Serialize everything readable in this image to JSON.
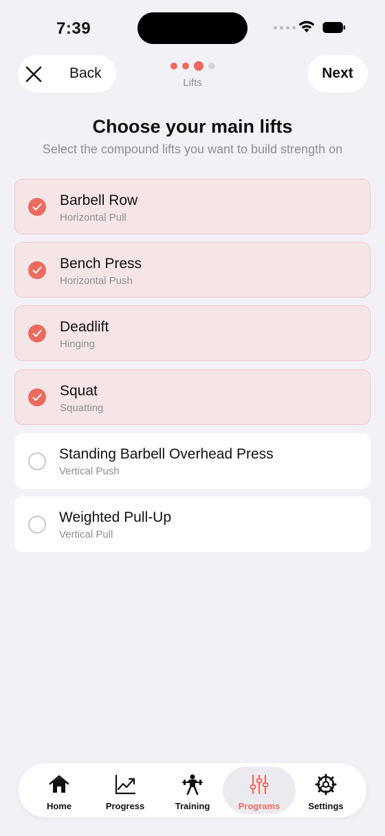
{
  "status_bar": {
    "time": "7:39"
  },
  "header": {
    "back_label": "Back",
    "next_label": "Next",
    "step_label": "Lifts",
    "steps": {
      "total": 4,
      "current": 3
    }
  },
  "title": "Choose your main lifts",
  "subtitle": "Select the compound lifts you want to build strength on",
  "lifts": [
    {
      "name": "Barbell Row",
      "category": "Horizontal Pull",
      "selected": true
    },
    {
      "name": "Bench Press",
      "category": "Horizontal Push",
      "selected": true
    },
    {
      "name": "Deadlift",
      "category": "Hinging",
      "selected": true
    },
    {
      "name": "Squat",
      "category": "Squatting",
      "selected": true
    },
    {
      "name": "Standing Barbell Overhead Press",
      "category": "Vertical Push",
      "selected": false
    },
    {
      "name": "Weighted Pull-Up",
      "category": "Vertical Pull",
      "selected": false
    }
  ],
  "tabs": [
    {
      "label": "Home",
      "icon": "house-icon",
      "active": false
    },
    {
      "label": "Progress",
      "icon": "chart-line-icon",
      "active": false
    },
    {
      "label": "Training",
      "icon": "weightlifter-icon",
      "active": false
    },
    {
      "label": "Programs",
      "icon": "sliders-icon",
      "active": true
    },
    {
      "label": "Settings",
      "icon": "gear-icon",
      "active": false
    }
  ],
  "colors": {
    "accent": "#ec6a5e",
    "background": "#f2f1f6",
    "selected_bg": "#f6e5e7",
    "selected_border": "#f1c8ca"
  }
}
